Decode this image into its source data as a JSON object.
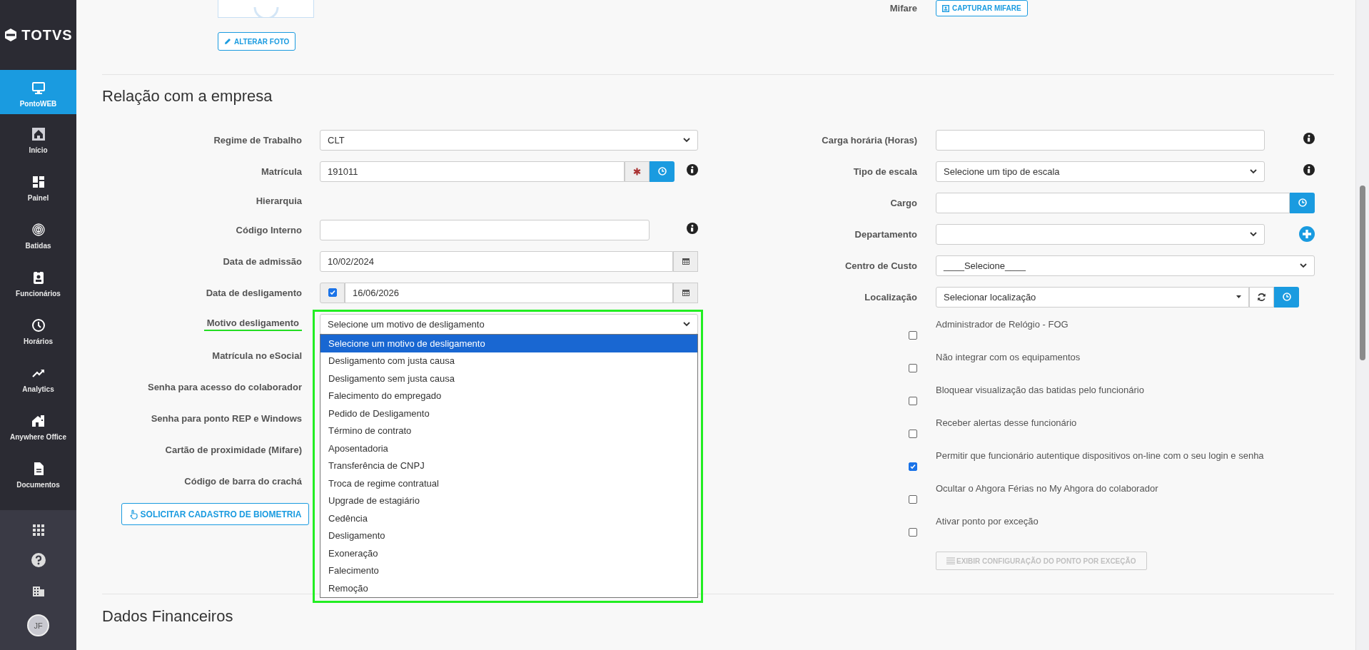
{
  "sidebar": {
    "brand": "TOTVS",
    "items": [
      {
        "label": "PontoWEB",
        "selected": true
      },
      {
        "label": "Início",
        "selected": false
      },
      {
        "label": "Painel",
        "selected": false
      },
      {
        "label": "Batidas",
        "selected": false
      },
      {
        "label": "Funcionários",
        "selected": false
      },
      {
        "label": "Horários",
        "selected": false
      },
      {
        "label": "Analytics",
        "selected": false
      },
      {
        "label": "Anywhere Office",
        "selected": false
      },
      {
        "label": "Documentos",
        "selected": false
      }
    ],
    "avatar": "JF"
  },
  "photo_section": {
    "photo_button": "ALTERAR FOTO",
    "mifare_label": "Mifare",
    "mifare_button": "CAPTURAR MIFARE"
  },
  "section_title": "Relação com a empresa",
  "left_fields": [
    {
      "kind": "select",
      "label": "Regime de Trabalho",
      "value": "CLT"
    },
    {
      "kind": "input_group",
      "label": "Matrícula",
      "value": "191011",
      "info": true
    },
    {
      "kind": "label_only",
      "label": "Hierarquia"
    },
    {
      "kind": "input",
      "label": "Código Interno",
      "info": true
    },
    {
      "kind": "date",
      "label": "Data de admissão",
      "value": "10/02/2024"
    },
    {
      "kind": "date_check",
      "label": "Data de desligamento",
      "value": "16/06/2026",
      "checked": true
    },
    {
      "kind": "dropdown",
      "label": "Motivo desligamento",
      "value": "Selecione um motivo de desligamento",
      "expanded": true,
      "options": [
        {
          "label": "Selecione um motivo de desligamento",
          "selected": true
        },
        {
          "label": "Desligamento com justa causa",
          "selected": false
        },
        {
          "label": "Desligamento sem justa causa",
          "selected": false
        },
        {
          "label": "Falecimento do empregado",
          "selected": false
        },
        {
          "label": "Pedido de Desligamento",
          "selected": false
        },
        {
          "label": "Término de contrato",
          "selected": false
        },
        {
          "label": "Aposentadoria",
          "selected": false
        },
        {
          "label": "Transferência de CNPJ",
          "selected": false
        },
        {
          "label": "Troca de regime contratual",
          "selected": false
        },
        {
          "label": "Upgrade de estagiário",
          "selected": false
        },
        {
          "label": "Cedência",
          "selected": false
        },
        {
          "label": "Desligamento",
          "selected": false
        },
        {
          "label": "Exoneração",
          "selected": false
        },
        {
          "label": "Falecimento",
          "selected": false
        },
        {
          "label": "Remoção",
          "selected": false
        }
      ]
    },
    {
      "kind": "label_only",
      "label": "Matrícula no eSocial"
    },
    {
      "kind": "label_only",
      "label": "Senha para acesso do colaborador"
    },
    {
      "kind": "label_only",
      "label": "Senha para ponto REP e Windows"
    },
    {
      "kind": "label_only",
      "label": "Cartão de proximidade (Mifare)"
    },
    {
      "kind": "label_only",
      "label": "Código de barra do crachá"
    }
  ],
  "biometry_button": "SOLICITAR CADASTRO DE BIOMETRIA",
  "right_fields": [
    {
      "kind": "input",
      "label": "Carga horária (Horas)",
      "info": true
    },
    {
      "kind": "select",
      "label": "Tipo de escala",
      "value": "Selecione um tipo de escala",
      "info": true
    },
    {
      "kind": "input_button",
      "label": "Cargo"
    },
    {
      "kind": "select_plus",
      "label": "Departamento"
    },
    {
      "kind": "select_wide",
      "label": "Centro de Custo",
      "value": "____Selecione____"
    },
    {
      "kind": "combo",
      "label": "Localização",
      "value": "Selecionar localização"
    }
  ],
  "checkboxes": [
    {
      "label": "Administrador de Relógio - FOG",
      "checked": false
    },
    {
      "label": "Não integrar com os equipamentos",
      "checked": false
    },
    {
      "label": "Bloquear visualização das batidas pelo funcionário",
      "checked": false
    },
    {
      "label": "Receber alertas desse funcionário",
      "checked": false
    },
    {
      "label": "Permitir que funcionário autentique dispositivos on-line com o seu login e senha",
      "checked": true
    },
    {
      "label": "Ocultar o Ahgora Férias no My Ahgora do colaborador",
      "checked": false
    },
    {
      "label": "Ativar ponto por exceção",
      "checked": false
    }
  ],
  "exception_button": {
    "label": "EXIBIR CONFIGURAÇÃO DO PONTO POR EXCEÇÃO",
    "disabled": true
  },
  "next_section_title": "Dados Financeiros"
}
